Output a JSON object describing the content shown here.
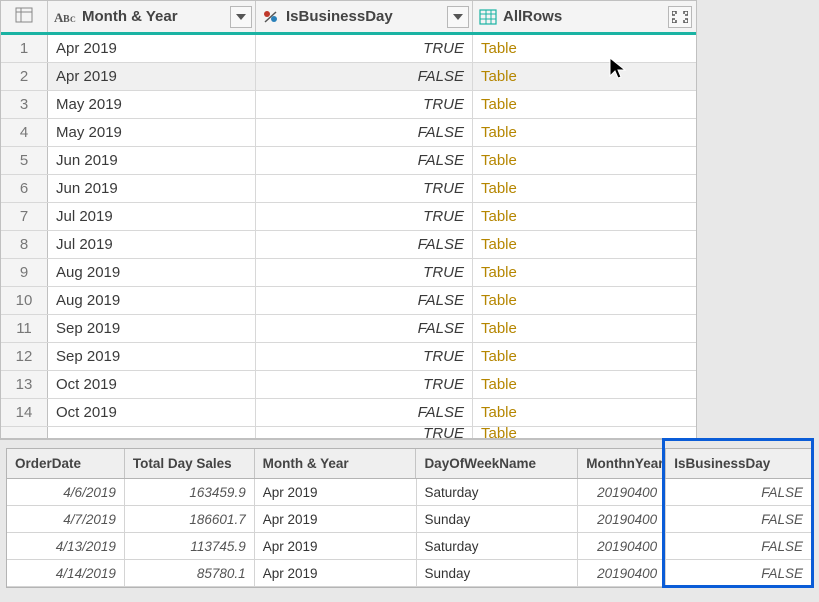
{
  "mainGrid": {
    "columns": [
      {
        "label": "Month & Year",
        "typeIcon": "text-icon"
      },
      {
        "label": "IsBusinessDay",
        "typeIcon": "formula-icon"
      },
      {
        "label": "AllRows",
        "typeIcon": "table-icon"
      }
    ],
    "rows": [
      {
        "n": "1",
        "month": "Apr 2019",
        "biz": "TRUE",
        "all": "Table"
      },
      {
        "n": "2",
        "month": "Apr 2019",
        "biz": "FALSE",
        "all": "Table"
      },
      {
        "n": "3",
        "month": "May 2019",
        "biz": "TRUE",
        "all": "Table"
      },
      {
        "n": "4",
        "month": "May 2019",
        "biz": "FALSE",
        "all": "Table"
      },
      {
        "n": "5",
        "month": "Jun 2019",
        "biz": "FALSE",
        "all": "Table"
      },
      {
        "n": "6",
        "month": "Jun 2019",
        "biz": "TRUE",
        "all": "Table"
      },
      {
        "n": "7",
        "month": "Jul 2019",
        "biz": "TRUE",
        "all": "Table"
      },
      {
        "n": "8",
        "month": "Jul 2019",
        "biz": "FALSE",
        "all": "Table"
      },
      {
        "n": "9",
        "month": "Aug 2019",
        "biz": "TRUE",
        "all": "Table"
      },
      {
        "n": "10",
        "month": "Aug 2019",
        "biz": "FALSE",
        "all": "Table"
      },
      {
        "n": "11",
        "month": "Sep 2019",
        "biz": "FALSE",
        "all": "Table"
      },
      {
        "n": "12",
        "month": "Sep 2019",
        "biz": "TRUE",
        "all": "Table"
      },
      {
        "n": "13",
        "month": "Oct 2019",
        "biz": "TRUE",
        "all": "Table"
      },
      {
        "n": "14",
        "month": "Oct 2019",
        "biz": "FALSE",
        "all": "Table"
      }
    ],
    "cutoff": {
      "biz": "TRUE",
      "all": "Table"
    }
  },
  "previewGrid": {
    "columns": [
      "OrderDate",
      "Total Day Sales",
      "Month & Year",
      "DayOfWeekName",
      "MonthnYear",
      "IsBusinessDay"
    ],
    "rows": [
      {
        "date": "4/6/2019",
        "sales": "163459.9",
        "month": "Apr 2019",
        "dow": "Saturday",
        "my": "20190400",
        "biz": "FALSE"
      },
      {
        "date": "4/7/2019",
        "sales": "186601.7",
        "month": "Apr 2019",
        "dow": "Sunday",
        "my": "20190400",
        "biz": "FALSE"
      },
      {
        "date": "4/13/2019",
        "sales": "113745.9",
        "month": "Apr 2019",
        "dow": "Saturday",
        "my": "20190400",
        "biz": "FALSE"
      },
      {
        "date": "4/14/2019",
        "sales": "85780.1",
        "month": "Apr 2019",
        "dow": "Sunday",
        "my": "20190400",
        "biz": "FALSE"
      }
    ]
  }
}
